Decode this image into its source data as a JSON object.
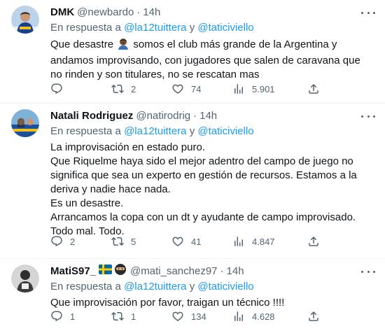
{
  "tweets": [
    {
      "name": "DMK",
      "handle": "@newbardo",
      "dot": "·",
      "time": "14h",
      "reply_prefix": "En respuesta a",
      "mention1": "@la12tuittera",
      "conj": "y",
      "mention2": "@taticiviello",
      "text_before_emoji": "Que desastre",
      "text_after_emoji": "somos el club más grande de la Argentina y andamos improvisando, con jugadores que salen de caravana que no rinden y son titulares, no se rescatan mas",
      "replies": "",
      "retweets": "2",
      "likes": "74",
      "views": "5.901"
    },
    {
      "name": "Natali Rodriguez",
      "handle": "@natirodrig",
      "dot": "·",
      "time": "14h",
      "reply_prefix": "En respuesta a",
      "mention1": "@la12tuittera",
      "conj": "y",
      "mention2": "@taticiviello",
      "lines": [
        "La improvisación en estado puro.",
        "Que Riquelme haya sido el mejor adentro del campo de juego no significa que sea un experto en gestión de recursos. Estamos a la deriva y nadie hace nada.",
        "Es un desastre.",
        "Arrancamos la copa con un dt y ayudante de campo improvisado.",
        "Todo mal. Todo."
      ],
      "replies": "2",
      "retweets": "5",
      "likes": "41",
      "views": "4.847"
    },
    {
      "name": "MatiS97_",
      "handle": "@mati_sanchez97",
      "dot": "·",
      "time": "14h",
      "reply_prefix": "En respuesta a",
      "mention1": "@la12tuittera",
      "conj": "y",
      "mention2": "@taticiviello",
      "text": "Que improvisación por favor, traigan un técnico !!!!",
      "replies": "1",
      "retweets": "1",
      "likes": "134",
      "views": "4.628"
    }
  ],
  "icons": {
    "reply": "reply-icon",
    "retweet": "retweet-icon",
    "like": "heart-icon",
    "views": "views-icon",
    "share": "share-icon",
    "more": "more-icon"
  },
  "colors": {
    "link": "#1d9bf0",
    "secondary": "#536471",
    "text": "#0f1419",
    "divider": "#eff3f4"
  }
}
